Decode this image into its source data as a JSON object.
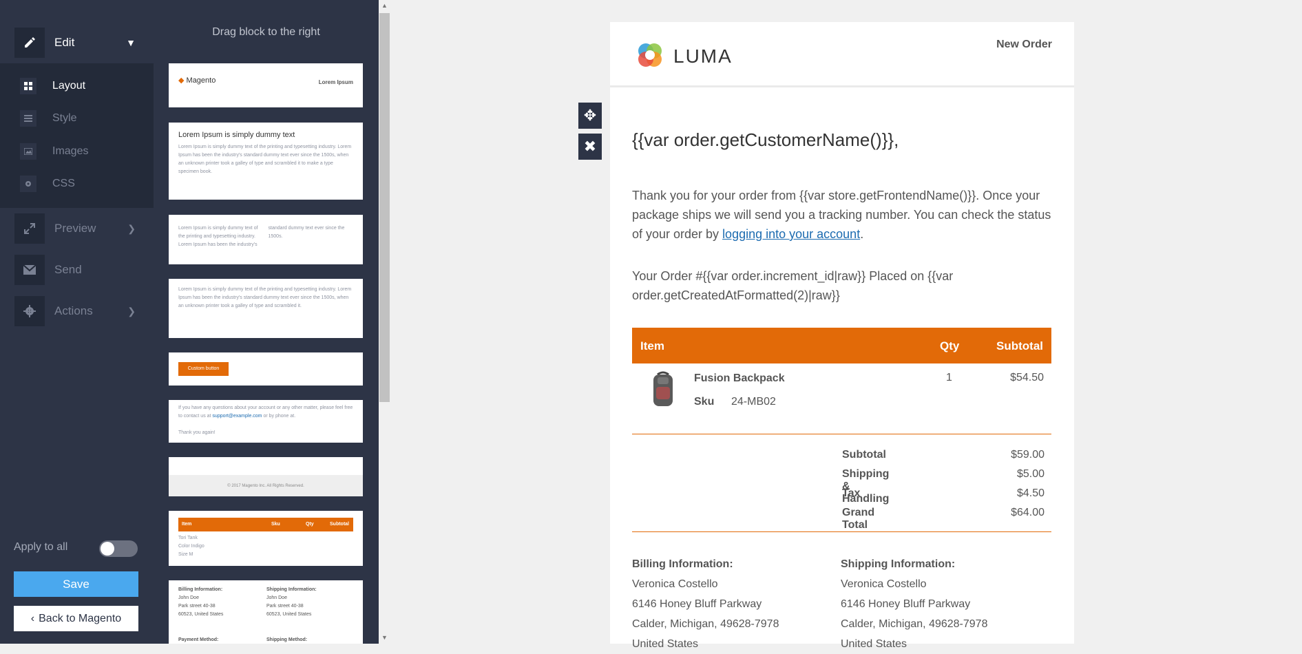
{
  "sidebar": {
    "edit_label": "Edit",
    "layout_label": "Layout",
    "style_label": "Style",
    "images_label": "Images",
    "css_label": "CSS",
    "preview_label": "Preview",
    "send_label": "Send",
    "actions_label": "Actions",
    "apply_to_all": "Apply to all",
    "save_label": "Save",
    "back_label": "Back to Magento"
  },
  "blocks": {
    "hint": "Drag block to the right",
    "header_brand": "Magento",
    "header_right": "Lorem Ipsum",
    "heading": "Lorem Ipsum is simply dummy text",
    "button_label": "Custom button",
    "footer_text": "© 2017 Magento Inc. All Rights Reserved.",
    "table_headers": [
      "Item",
      "Sku",
      "Qty",
      "Subtotal"
    ],
    "billing_label": "Billing Information:",
    "shipping_label": "Shipping Information:",
    "payment_label": "Payment Method:",
    "shipping_method_label": "Shipping Method:"
  },
  "email": {
    "logo_text": "LUMA",
    "new_order": "New Order",
    "greeting": "{{var order.getCustomerName()}},",
    "thanks_text": "Thank you for your order from {{var store.getFrontendName()}}. Once your package ships we will send you a tracking number. You can check the status of your order by ",
    "account_link": "logging into your account",
    "thanks_end": ".",
    "order_line": "Your Order #{{var order.increment_id|raw}} Placed on {{var order.getCreatedAtFormatted(2)|raw}}",
    "table": {
      "col_item": "Item",
      "col_qty": "Qty",
      "col_subtotal": "Subtotal",
      "product_name": "Fusion Backpack",
      "sku_label": "Sku",
      "sku_value": "24-MB02",
      "qty": "1",
      "subtotal": "$54.50"
    },
    "totals": [
      {
        "label": "Subtotal",
        "value": "$59.00"
      },
      {
        "label": "Shipping & Handling",
        "value": "$5.00"
      },
      {
        "label": "Tax",
        "value": "$4.50"
      },
      {
        "label": "Grand Total",
        "value": "$64.00"
      }
    ],
    "billing": {
      "title": "Billing Information:",
      "name": "Veronica Costello",
      "street": "6146 Honey Bluff Parkway",
      "city": "Calder, Michigan, 49628-7978",
      "country": "United States"
    },
    "shipping": {
      "title": "Shipping Information:",
      "name": "Veronica Costello",
      "street": "6146 Honey Bluff Parkway",
      "city": "Calder, Michigan, 49628-7978",
      "country": "United States"
    }
  },
  "colors": {
    "sidebar_bg": "#2d3446",
    "accent_orange": "#e26a08",
    "save_blue": "#4aa8ee",
    "link_blue": "#1c6bb0"
  }
}
